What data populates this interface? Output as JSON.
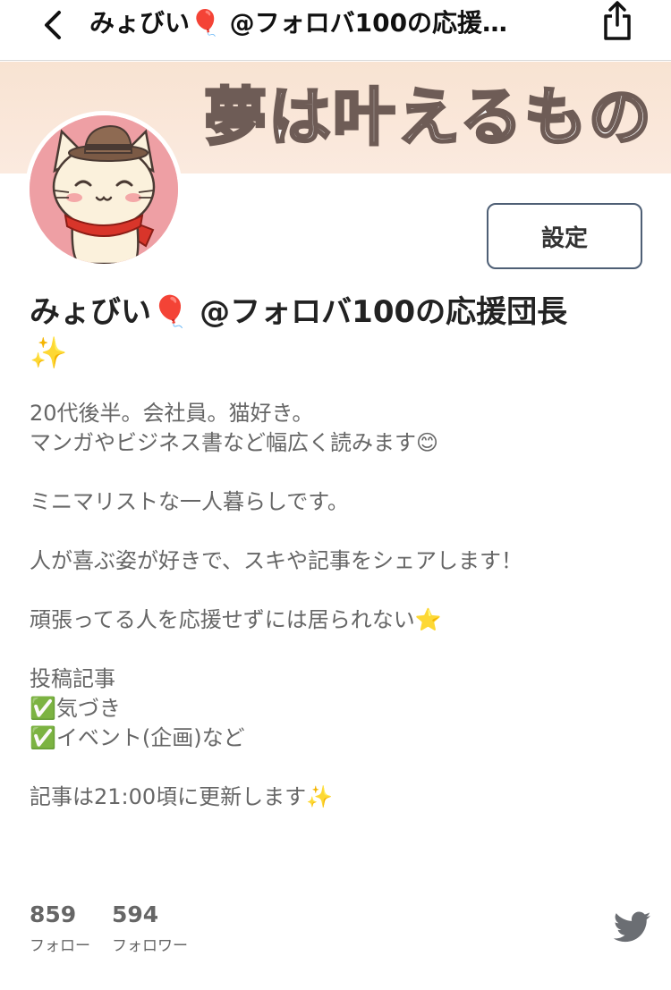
{
  "header": {
    "title": "みょびい🎈 @フォロバ100の応援…",
    "back_icon": "chevron-left-icon",
    "share_icon": "share-icon"
  },
  "banner": {
    "text": "夢は叶えるもの",
    "color": "#f8e3d2"
  },
  "avatar": {
    "alt": "cat-with-hat-avatar",
    "caption": "みょびい",
    "background": "#ee9fa4"
  },
  "settings_button": {
    "label": "設定"
  },
  "profile": {
    "name": "みょびい🎈 @フォロバ100の応援団長",
    "name_sparkle": "✨"
  },
  "bio": {
    "line1": "20代後半。会社員。猫好き。",
    "line2": "マンガやビジネス書など幅広く読みます😊",
    "line3": "ミニマリストな一人暮らしです。",
    "line4": "人が喜ぶ姿が好きで、スキや記事をシェアします！",
    "line5": "頑張ってる人を応援せずには居られない⭐️",
    "line6": "投稿記事",
    "line7": "✅気づき",
    "line8": "✅イベント(企画)など",
    "line9": "記事は21:00頃に更新します✨"
  },
  "stats": {
    "following_count": "859",
    "following_label": "フォロー",
    "followers_count": "594",
    "followers_label": "フォロワー"
  },
  "twitter": {
    "icon": "twitter-bird-icon",
    "color": "#6b6e73"
  }
}
